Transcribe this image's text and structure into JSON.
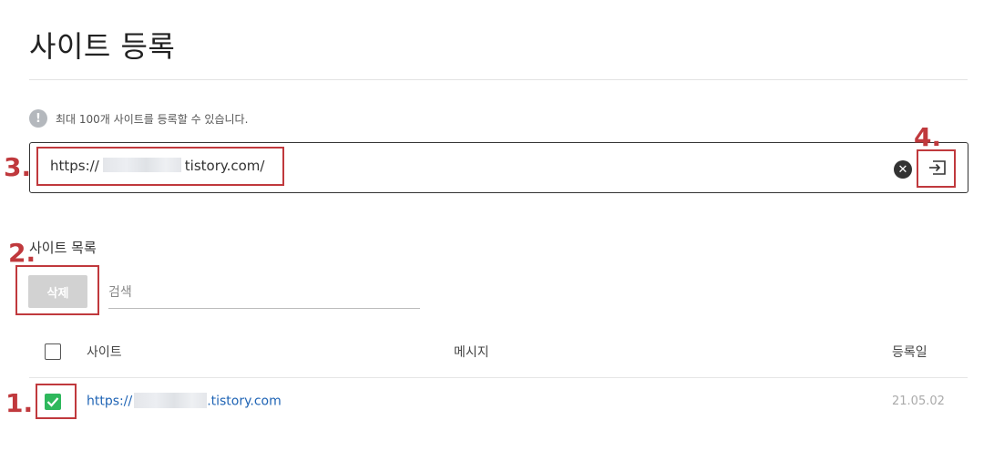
{
  "page": {
    "title": "사이트 등록"
  },
  "notice": {
    "icon": "info-icon",
    "icon_glyph": "!",
    "text": "최대 100개 사이트를 등록할 수 있습니다."
  },
  "url_input": {
    "value_prefix": "https://",
    "value_suffix": "tistory.com/",
    "clear_icon": "clear-icon",
    "clear_glyph": "✕",
    "submit_icon": "enter-icon"
  },
  "site_list": {
    "title": "사이트 목록",
    "delete_label": "삭제",
    "search_placeholder": "검색",
    "columns": {
      "site": "사이트",
      "message": "메시지",
      "date": "등록일"
    },
    "rows": [
      {
        "url_prefix": "https://",
        "url_suffix": ".tistory.com",
        "message": "",
        "date": "21.05.02",
        "checked": true
      }
    ]
  },
  "annotations": {
    "labels": [
      "1.",
      "2.",
      "3.",
      "4."
    ],
    "color": "#c0393d"
  },
  "colors": {
    "accent_green": "#2eb85c",
    "link_blue": "#1f64b5",
    "delete_disabled": "#d2d2d2"
  }
}
